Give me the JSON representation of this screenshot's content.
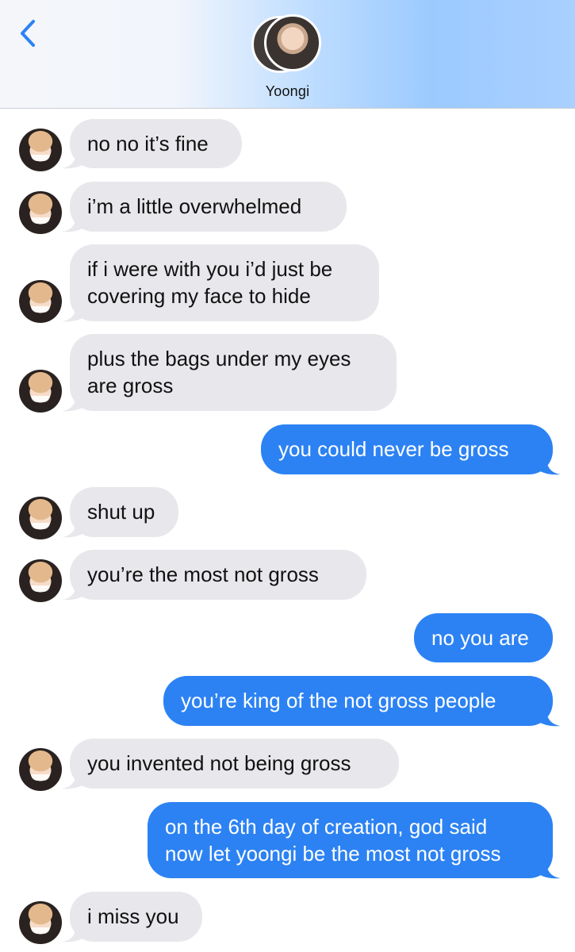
{
  "header": {
    "contact_name": "Yoongi",
    "back_icon": "chevron-left-icon",
    "accent_color": "#2c82f3"
  },
  "messages": [
    {
      "sender": "them",
      "lines": [
        "no no it’s fine"
      ]
    },
    {
      "sender": "them",
      "lines": [
        "i’m a little overwhelmed"
      ]
    },
    {
      "sender": "them",
      "lines": [
        "if i were with you i’d just be",
        "covering my face to hide"
      ]
    },
    {
      "sender": "them",
      "lines": [
        "plus the bags under my eyes",
        "are gross"
      ]
    },
    {
      "sender": "me",
      "lines": [
        "you could never be gross"
      ]
    },
    {
      "sender": "them",
      "lines": [
        "shut up"
      ]
    },
    {
      "sender": "them",
      "lines": [
        "you’re the most not gross"
      ]
    },
    {
      "sender": "me",
      "lines": [
        "no you are"
      ]
    },
    {
      "sender": "me",
      "lines": [
        "you’re king of the not gross people"
      ]
    },
    {
      "sender": "them",
      "lines": [
        "you invented not being gross"
      ]
    },
    {
      "sender": "me",
      "lines": [
        "on the 6th day of creation, god said",
        "now let yoongi be the most not gross"
      ]
    },
    {
      "sender": "them",
      "lines": [
        "i miss you"
      ]
    }
  ]
}
